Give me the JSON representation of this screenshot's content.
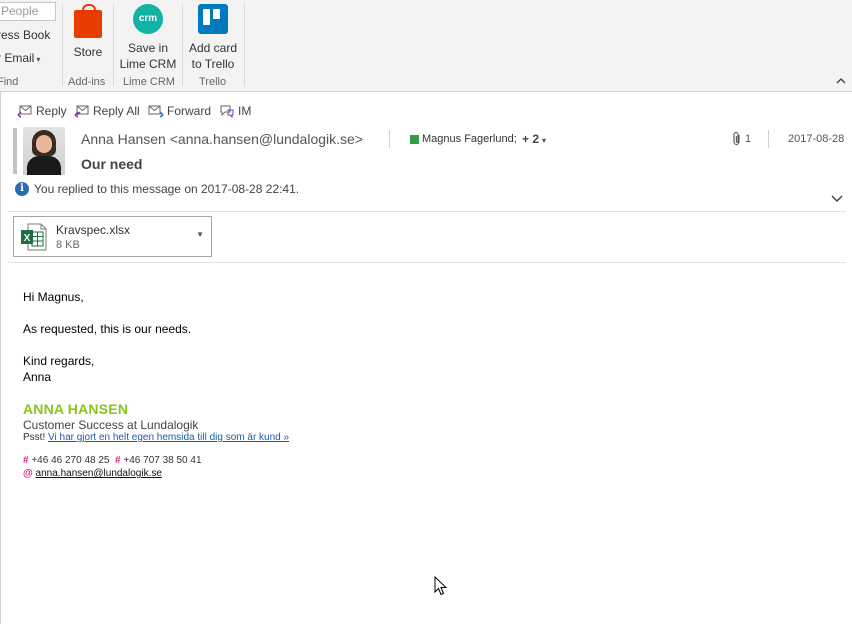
{
  "ribbon": {
    "search_placeholder": "People",
    "address_book_label": "ress Book",
    "filter_email_label": "r Email",
    "find_group_label": "Find",
    "store_label": "Store",
    "addins_group_label": "Add-ins",
    "save_crm_line1": "Save in",
    "save_crm_line2": "Lime CRM",
    "crm_icon_text": "crm",
    "lime_group_label": "Lime CRM",
    "trello_line1": "Add card",
    "trello_line2": "to Trello",
    "trello_group_label": "Trello"
  },
  "actions": {
    "reply": "Reply",
    "reply_all": "Reply All",
    "forward": "Forward",
    "im": "IM"
  },
  "message": {
    "sender": "Anna Hansen <anna.hansen@lundalogik.se>",
    "to_name": "Magnus Fagerlund;",
    "to_more": "+ 2",
    "attachment_count": "1",
    "date": "2017-08-28",
    "subject": "Our need",
    "info_notice": "You replied to this message on 2017-08-28 22:41."
  },
  "attachment": {
    "name": "Kravspec.xlsx",
    "size": "8 KB",
    "icon_letter": "X"
  },
  "body": {
    "greeting": "Hi Magnus,",
    "line1": "As requested, this is our needs.",
    "closing": "Kind regards,",
    "name": "Anna"
  },
  "signature": {
    "name": "ANNA HANSEN",
    "role": "Customer Success at Lundalogik",
    "psst_prefix": "Psst!",
    "psst_link": "Vi har gjort en helt egen hemsida till dig som är kund »",
    "phone1": "+46 46 270 48 25",
    "phone2": "+46 707 38 50 41",
    "email": "anna.hansen@lundalogik.se"
  },
  "colors": {
    "signature_green": "#8dc21f",
    "accent_pink": "#e2197e",
    "link_blue": "#1a5ea8",
    "store_orange": "#eb3c00",
    "crm_teal": "#12b3a5",
    "trello_blue": "#0079bf",
    "excel_green": "#1d7044",
    "contact_status_green": "#2f9e44"
  }
}
